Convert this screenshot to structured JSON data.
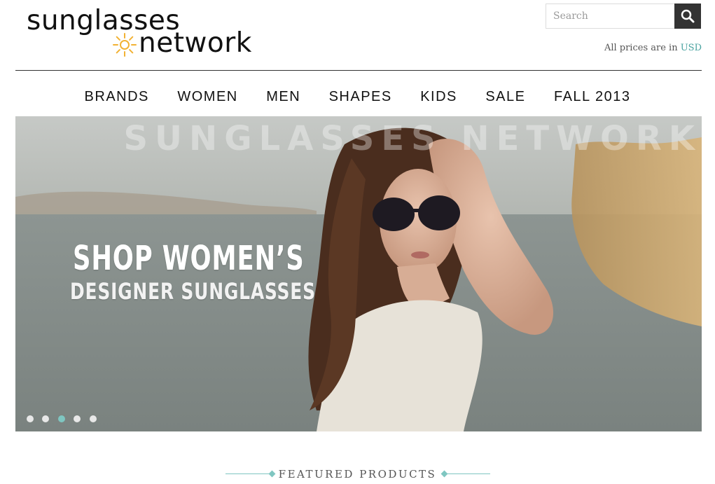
{
  "header": {
    "logo": {
      "line1": "sunglasses",
      "line2": "network"
    },
    "search": {
      "placeholder": "Search"
    },
    "prices": {
      "prefix": "All prices are in ",
      "currency": "USD"
    }
  },
  "nav": {
    "items": [
      "BRANDS",
      "WOMEN",
      "MEN",
      "SHAPES",
      "KIDS",
      "SALE",
      "FALL 2013"
    ]
  },
  "hero": {
    "watermark": "SUNGLASSES NETWORK",
    "headline": "SHOP WOMEN’S",
    "subheadline": "DESIGNER SUNGLASSES",
    "slides": {
      "count": 5,
      "active_index": 2
    }
  },
  "featured": {
    "title": "FEATURED PRODUCTS"
  },
  "colors": {
    "accent": "#7fc6c1",
    "link": "#4aa3a0",
    "search_button": "#333333"
  }
}
